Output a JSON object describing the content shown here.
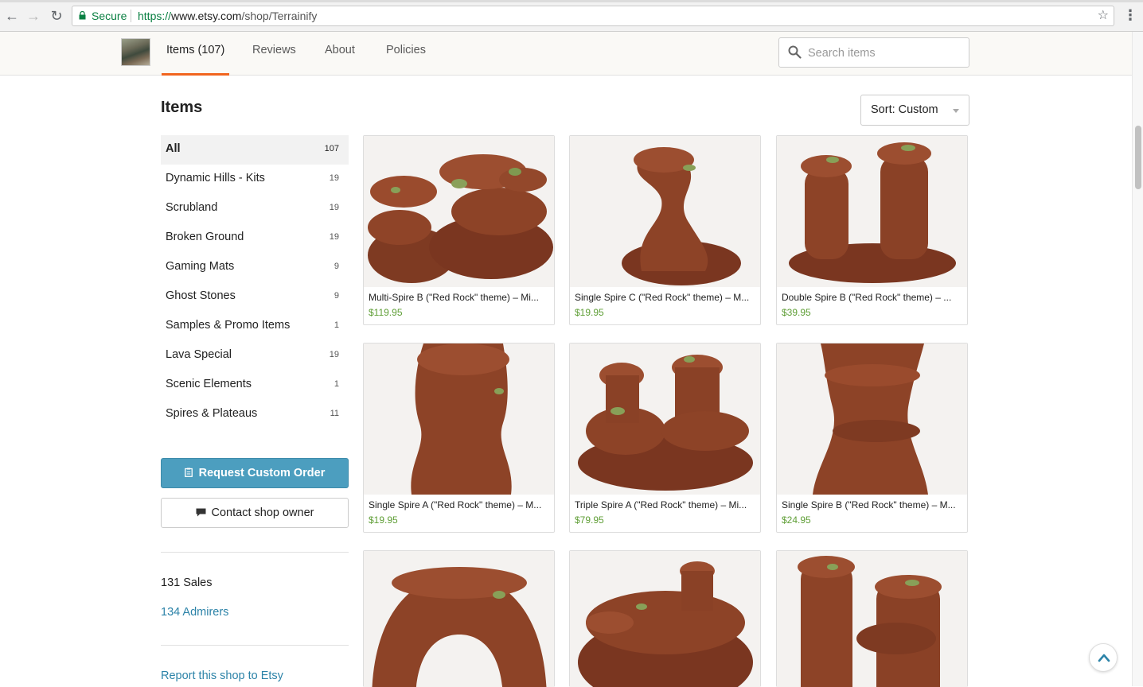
{
  "browser": {
    "back_icon": "back-arrow-icon",
    "forward_icon": "forward-arrow-icon",
    "reload_icon": "reload-icon",
    "secure_label": "Secure",
    "url_protocol": "https://",
    "url_host": "www.etsy.com",
    "url_path": "/shop/Terrainify",
    "bookmark_icon": "star-icon",
    "menu_icon": "kebab-menu-icon"
  },
  "shop_nav": {
    "tabs": [
      {
        "label": "Items (107)",
        "active": true
      },
      {
        "label": "Reviews",
        "active": false
      },
      {
        "label": "About",
        "active": false
      },
      {
        "label": "Policies",
        "active": false
      }
    ],
    "search_placeholder": "Search items",
    "accent_color": "#f1641e"
  },
  "main": {
    "title": "Items",
    "sort_label": "Sort: Custom"
  },
  "sidebar": {
    "categories": [
      {
        "label": "All",
        "count": "107",
        "active": true
      },
      {
        "label": "Dynamic Hills - Kits",
        "count": "19"
      },
      {
        "label": "Scrubland",
        "count": "19"
      },
      {
        "label": "Broken Ground",
        "count": "19"
      },
      {
        "label": "Gaming Mats",
        "count": "9"
      },
      {
        "label": "Ghost Stones",
        "count": "9"
      },
      {
        "label": "Samples & Promo Items",
        "count": "1"
      },
      {
        "label": "Lava Special",
        "count": "19"
      },
      {
        "label": "Scenic Elements",
        "count": "1"
      },
      {
        "label": "Spires & Plateaus",
        "count": "11"
      }
    ],
    "custom_order_label": "Request Custom Order",
    "contact_label": "Contact shop owner",
    "sales": "131 Sales",
    "admirers": "134 Admirers",
    "report": "Report this shop to Etsy",
    "button_color": "#4c9ebf",
    "link_color": "#2c83a8"
  },
  "listings": [
    {
      "title": "Multi-Spire B (\"Red Rock\" theme) – Mi...",
      "price": "$119.95"
    },
    {
      "title": "Single Spire C (\"Red Rock\" theme) – M...",
      "price": "$19.95"
    },
    {
      "title": "Double Spire B (\"Red Rock\" theme) – ...",
      "price": "$39.95"
    },
    {
      "title": "Single Spire A (\"Red Rock\" theme) – M...",
      "price": "$19.95"
    },
    {
      "title": "Triple Spire A (\"Red Rock\" theme) – Mi...",
      "price": "$79.95"
    },
    {
      "title": "Single Spire B (\"Red Rock\" theme) – M...",
      "price": "$24.95"
    }
  ],
  "price_color": "#5e9e35"
}
